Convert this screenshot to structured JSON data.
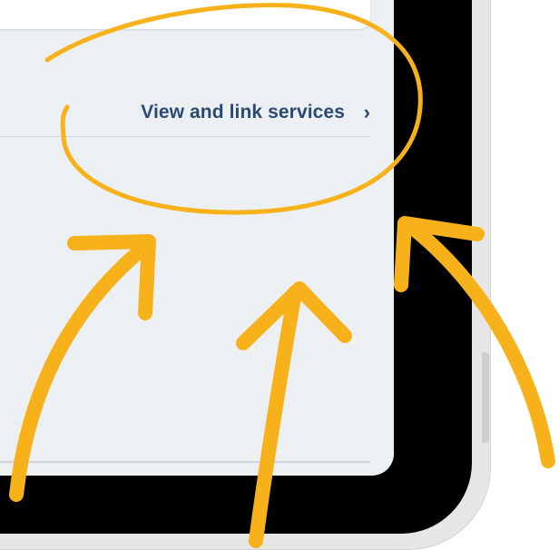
{
  "link_row": {
    "label": "View and link services",
    "chevron": "›"
  },
  "annotation": {
    "color": "#f7b21b",
    "shapes": [
      "ellipse-circle-highlight",
      "arrow-left",
      "arrow-center",
      "arrow-right"
    ]
  }
}
